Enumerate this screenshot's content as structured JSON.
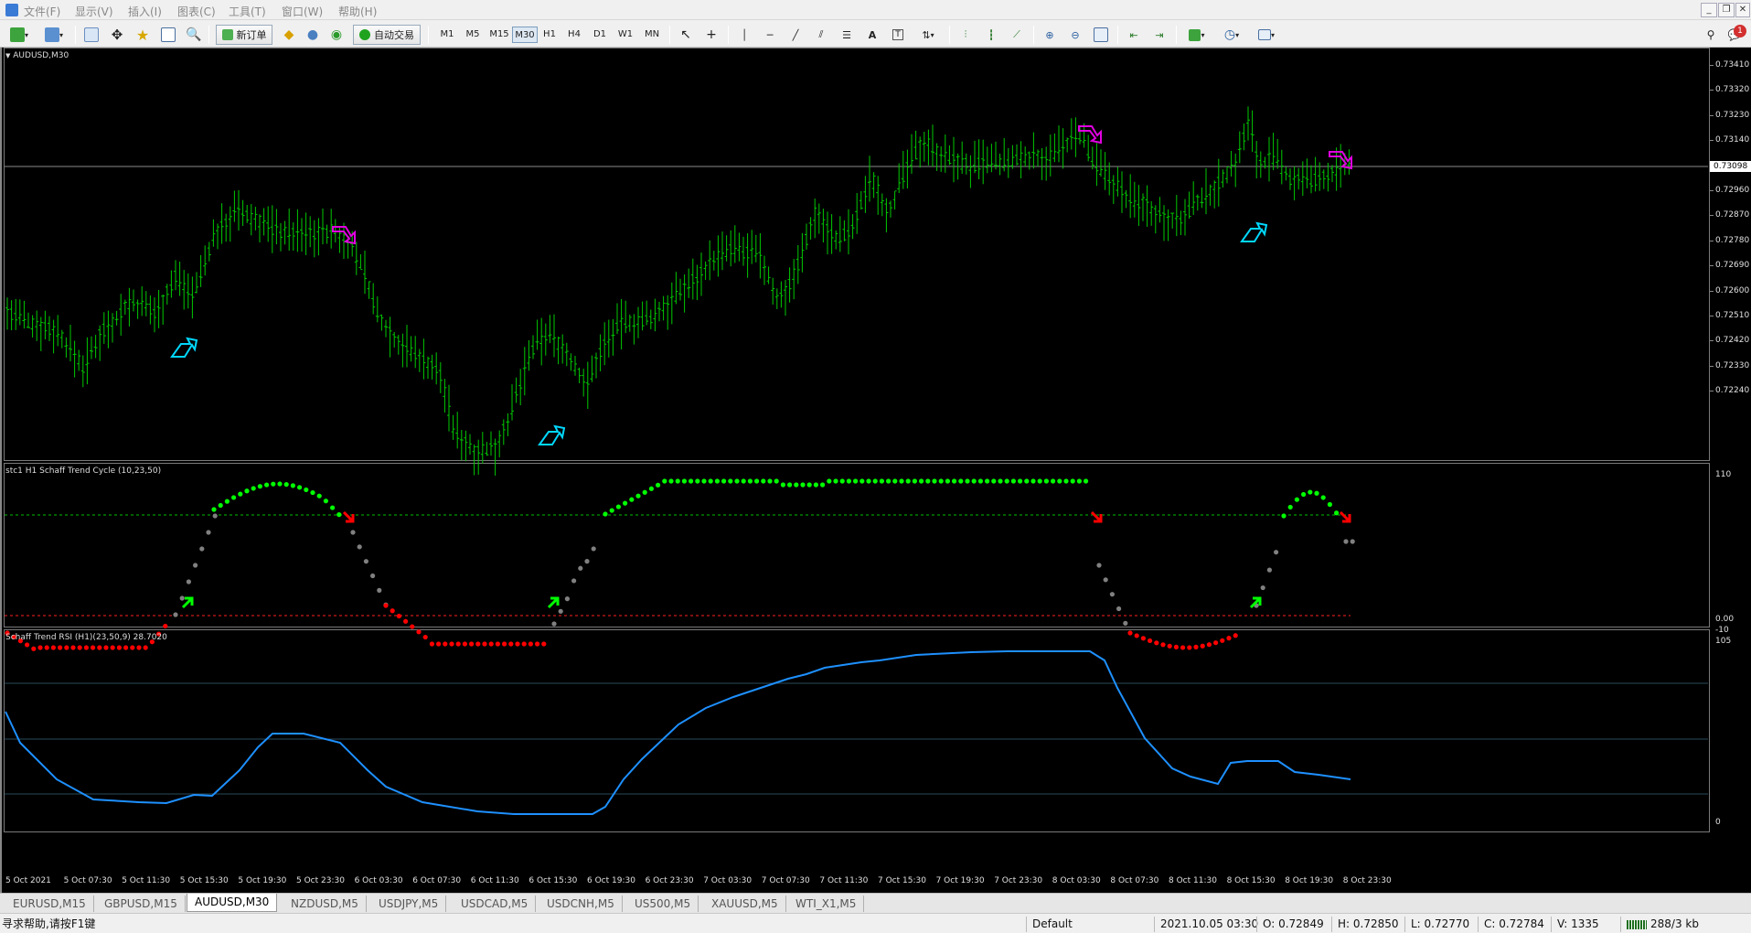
{
  "menu": {
    "items": [
      "文件(F)",
      "显示(V)",
      "插入(I)",
      "图表(C)",
      "工具(T)",
      "窗口(W)",
      "帮助(H)"
    ],
    "window_controls": [
      "_",
      "❐",
      "✕"
    ]
  },
  "toolbar": {
    "new_order_label": "新订单",
    "auto_trade_label": "自动交易",
    "timeframes": [
      "M1",
      "M5",
      "M15",
      "M30",
      "H1",
      "H4",
      "D1",
      "W1",
      "MN"
    ],
    "active_timeframe": "M30",
    "notification_count": "1"
  },
  "chart": {
    "main_title": "AUDUSD,M30",
    "indicator1_title": "stc1 H1 Schaff Trend Cycle (10,23,50)",
    "indicator2_title": "Schaff Trend RSI (H1)(23,50,9) 28.7020",
    "current_price": "0.73098",
    "price_labels": [
      "0.73410",
      "0.73320",
      "0.73230",
      "0.73140",
      "0.73050",
      "0.72960",
      "0.72870",
      "0.72780",
      "0.72690",
      "0.72600",
      "0.72510",
      "0.72420",
      "0.72330",
      "0.72240"
    ],
    "stc_labels": [
      "110",
      "0.00",
      "-10"
    ],
    "rsi_labels": [
      "105",
      "0"
    ],
    "time_labels": [
      "5 Oct 2021",
      "5 Oct 07:30",
      "5 Oct 11:30",
      "5 Oct 15:30",
      "5 Oct 19:30",
      "5 Oct 23:30",
      "6 Oct 03:30",
      "6 Oct 07:30",
      "6 Oct 11:30",
      "6 Oct 15:30",
      "6 Oct 19:30",
      "6 Oct 23:30",
      "7 Oct 03:30",
      "7 Oct 07:30",
      "7 Oct 11:30",
      "7 Oct 15:30",
      "7 Oct 19:30",
      "7 Oct 23:30",
      "8 Oct 03:30",
      "8 Oct 07:30",
      "8 Oct 11:30",
      "8 Oct 15:30",
      "8 Oct 19:30",
      "8 Oct 23:30"
    ],
    "colors": {
      "bars": "#00c800",
      "buy_arrow": "#00d8ff",
      "sell_arrow": "#e000e0",
      "stc_up": "#00ff00",
      "stc_down": "#ff0000",
      "stc_neutral": "#808080",
      "rsi_line": "#1e90ff"
    }
  },
  "tabs": {
    "items": [
      "EURUSD,M15",
      "GBPUSD,M15",
      "AUDUSD,M30",
      "NZDUSD,M5",
      "USDJPY,M5",
      "USDCAD,M5",
      "USDCNH,M5",
      "US500,M5",
      "XAUUSD,M5",
      "WTI_X1,M5"
    ],
    "active": "AUDUSD,M30"
  },
  "status": {
    "help_text": "寻求帮助,请按F1键",
    "profile": "Default",
    "datetime": "2021.10.05 03:30",
    "open": "O: 0.72849",
    "high": "H: 0.72850",
    "low": "L: 0.72770",
    "close": "C: 0.72784",
    "volume": "V: 1335",
    "traffic": "288/3 kb"
  }
}
